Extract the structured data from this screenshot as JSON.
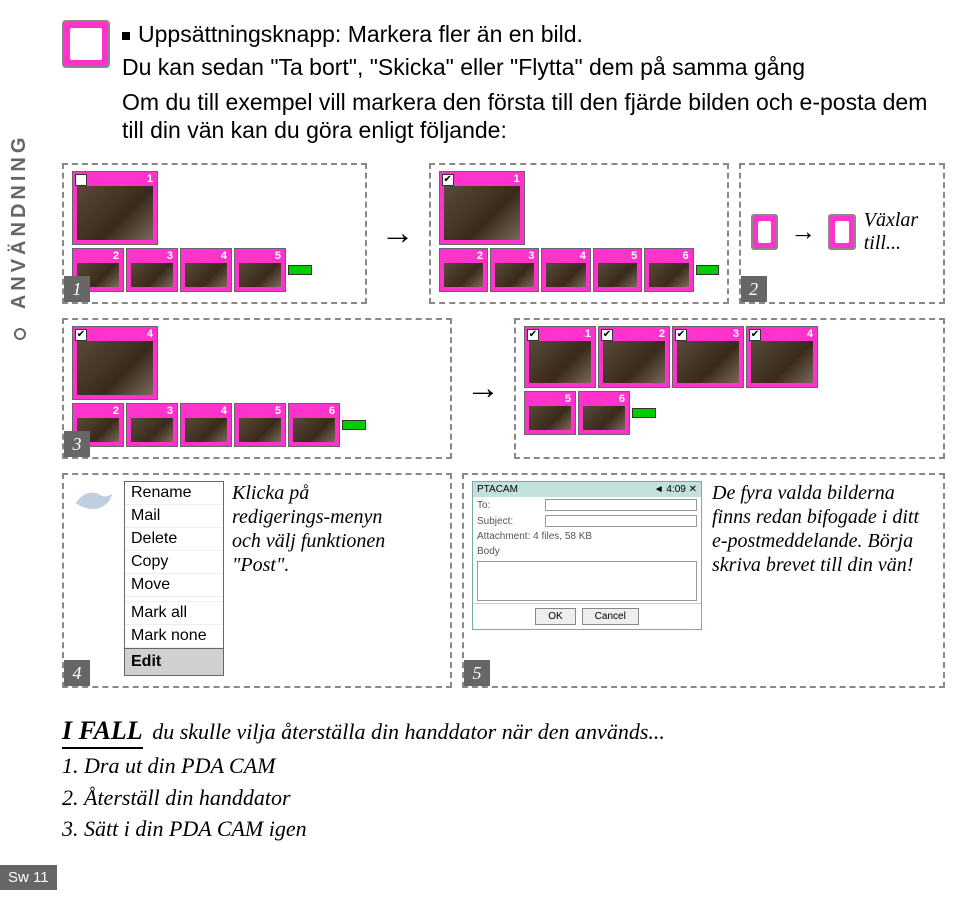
{
  "sidebar": {
    "label": "ANVÄNDNING"
  },
  "intro": {
    "line1": "Uppsättningsknapp: Markera fler än en bild.",
    "line2": "Du kan sedan \"Ta bort\", \"Skicka\" eller \"Flytta\" dem på samma gång",
    "line3": "Om du till exempel vill markera den första till den fjärde bilden och e-posta dem till din vän kan du göra enligt följande:"
  },
  "steps": {
    "s1": "1",
    "s2": "2",
    "s3": "3",
    "s4": "4",
    "s5": "5"
  },
  "toggle": {
    "text": "Växlar till..."
  },
  "menu": {
    "items": [
      "Rename",
      "Mail",
      "Delete",
      "Copy",
      "Move",
      "",
      "Mark all",
      "Mark none"
    ],
    "edit": "Edit"
  },
  "step4": {
    "text": "Klicka på redigerings-menyn och välj funktionen \"Post\"."
  },
  "step5": {
    "text": "De fyra valda bilderna finns redan bifogade i ditt e-postmeddelande. Börja skriva brevet till din vän!"
  },
  "email": {
    "titleLeft": "PTACAM",
    "titleRight": "◄ 4:09  ✕",
    "to": "To:",
    "subject": "Subject:",
    "attach": "Attachment: 4 files, 58 KB",
    "body": "Body",
    "ok": "OK",
    "cancel": "Cancel"
  },
  "ifail": {
    "head": "I FALL",
    "rest": " du skulle vilja återställa din handdator när den används...",
    "l1": "1. Dra ut din PDA CAM",
    "l2": "2. Återställ din handdator",
    "l3": "3. Sätt i din PDA CAM igen"
  },
  "page": "Sw 11"
}
